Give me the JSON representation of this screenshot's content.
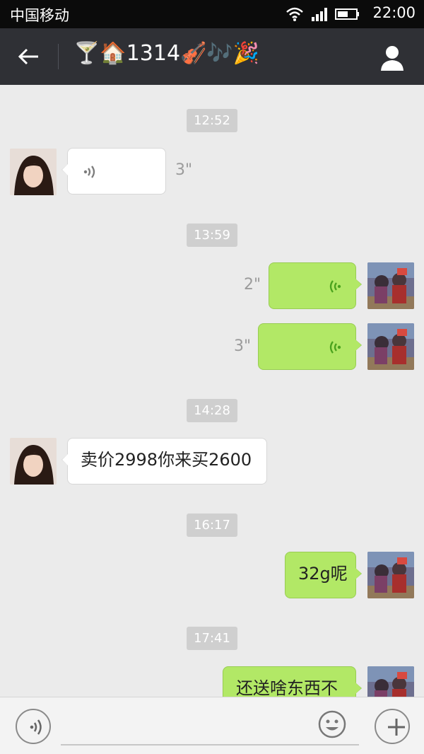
{
  "status_bar": {
    "carrier": "中国移动",
    "time": "22:00"
  },
  "header": {
    "title": "🍸🏠1314🎻🎶🎉"
  },
  "messages": [
    {
      "type": "timestamp",
      "text": "12:52"
    },
    {
      "type": "voice",
      "side": "left",
      "duration": "3\""
    },
    {
      "type": "timestamp",
      "text": "13:59"
    },
    {
      "type": "voice",
      "side": "right",
      "duration": "2\""
    },
    {
      "type": "voice",
      "side": "right",
      "duration": "3\""
    },
    {
      "type": "timestamp",
      "text": "14:28"
    },
    {
      "type": "text",
      "side": "left",
      "text": "卖价2998你来买2600"
    },
    {
      "type": "timestamp",
      "text": "16:17"
    },
    {
      "type": "text",
      "side": "right",
      "text": "32g呢"
    },
    {
      "type": "timestamp",
      "text": "17:41"
    },
    {
      "type": "text",
      "side": "right",
      "text": "还送啥东西不"
    }
  ],
  "input_bar": {
    "placeholder": ""
  },
  "colors": {
    "status_bg": "#0b0b0b",
    "header_bg": "#2f3035",
    "chat_bg": "#ebebeb",
    "sent_bubble": "#b2e866",
    "received_bubble": "#ffffff"
  },
  "icons": [
    "wifi-icon",
    "signal-icon",
    "battery-icon",
    "back-arrow-icon",
    "profile-icon",
    "voice-wave-icon",
    "emoji-icon",
    "plus-icon"
  ]
}
